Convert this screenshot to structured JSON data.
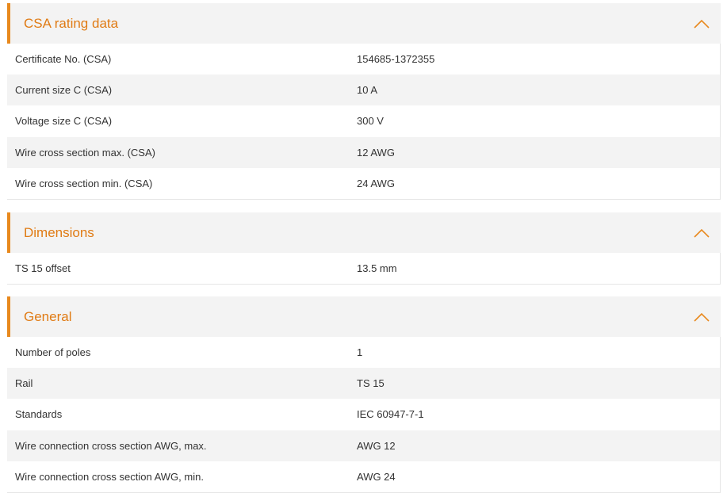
{
  "accent_color": "#e8891e",
  "sections": [
    {
      "title": "CSA rating data",
      "toggle_icon": "chevron-up-icon",
      "rows": [
        {
          "label": "Certificate No. (CSA)",
          "value": "154685-1372355"
        },
        {
          "label": "Current size C (CSA)",
          "value": "10 A"
        },
        {
          "label": "Voltage size C (CSA)",
          "value": "300 V"
        },
        {
          "label": "Wire cross section max. (CSA)",
          "value": "12 AWG"
        },
        {
          "label": "Wire cross section min. (CSA)",
          "value": "24 AWG"
        }
      ]
    },
    {
      "title": "Dimensions",
      "toggle_icon": "chevron-up-icon",
      "rows": [
        {
          "label": "TS 15 offset",
          "value": "13.5  mm"
        }
      ]
    },
    {
      "title": "General",
      "toggle_icon": "chevron-up-icon",
      "rows": [
        {
          "label": "Number of poles",
          "value": "1"
        },
        {
          "label": "Rail",
          "value": "TS 15"
        },
        {
          "label": "Standards",
          "value": "IEC 60947-7-1"
        },
        {
          "label": "Wire connection cross section AWG, max.",
          "value": "AWG 12"
        },
        {
          "label": "Wire connection cross section AWG, min.",
          "value": "AWG 24"
        }
      ]
    }
  ]
}
